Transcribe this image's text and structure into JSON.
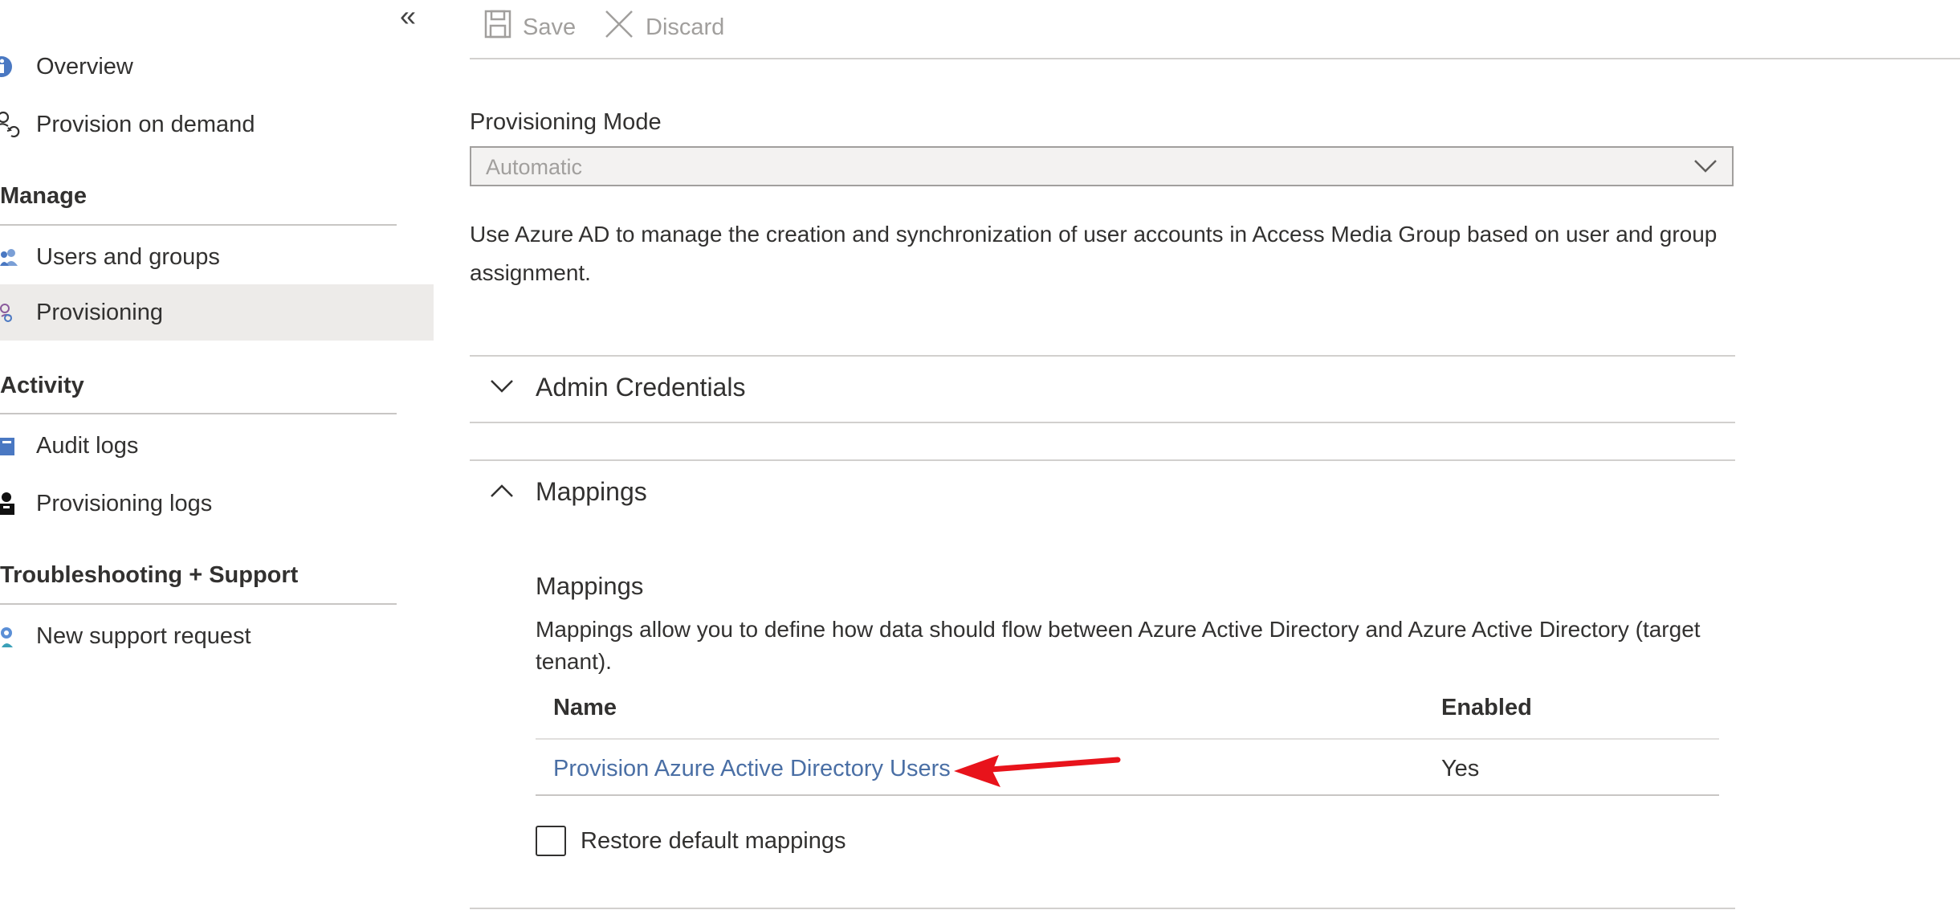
{
  "sidebar": {
    "collapse_glyph": "«",
    "items_top": [
      {
        "label": "Overview",
        "icon": "info-icon"
      },
      {
        "label": "Provision on demand",
        "icon": "provision-on-demand-icon"
      }
    ],
    "sections": [
      {
        "header": "Manage",
        "items": [
          {
            "label": "Users and groups",
            "icon": "users-icon",
            "selected": false
          },
          {
            "label": "Provisioning",
            "icon": "provisioning-icon",
            "selected": true
          }
        ]
      },
      {
        "header": "Activity",
        "items": [
          {
            "label": "Audit logs",
            "icon": "audit-log-icon"
          },
          {
            "label": "Provisioning logs",
            "icon": "provisioning-logs-icon"
          }
        ]
      },
      {
        "header": "Troubleshooting + Support",
        "items": [
          {
            "label": "New support request",
            "icon": "support-request-icon"
          }
        ]
      }
    ]
  },
  "toolbar": {
    "save_label": "Save",
    "discard_label": "Discard"
  },
  "main": {
    "provisioning_mode_label": "Provisioning Mode",
    "provisioning_mode_value": "Automatic",
    "description": "Use Azure AD to manage the creation and synchronization of user accounts in Access Media Group based on user and group assignment.",
    "admin_credentials_title": "Admin Credentials",
    "mappings_section_title": "Mappings",
    "mappings_title": "Mappings",
    "mappings_description": "Mappings allow you to define how data should flow between Azure Active Directory and Azure Active Directory (target tenant).",
    "table": {
      "headers": [
        "Name",
        "Enabled"
      ],
      "rows": [
        {
          "name": "Provision Azure Active Directory Users",
          "enabled": "Yes"
        }
      ]
    },
    "restore_default_label": "Restore default mappings"
  },
  "colors": {
    "link": "#4a6fa5",
    "selected_bg": "#edebe9",
    "annotation_arrow": "#e8131b",
    "info_icon": "#4a78c2"
  }
}
